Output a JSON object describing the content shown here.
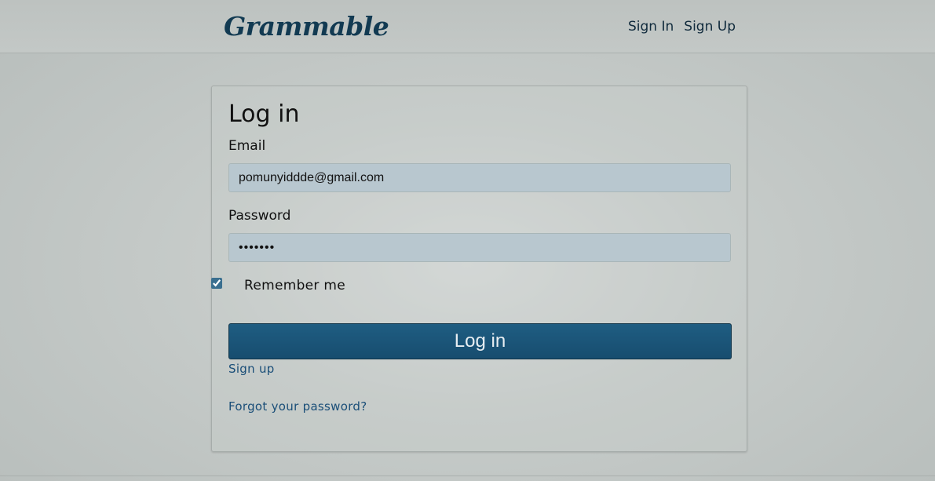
{
  "navbar": {
    "brand": "Grammable",
    "links": [
      {
        "label": "Sign In"
      },
      {
        "label": "Sign Up"
      }
    ]
  },
  "form": {
    "title": "Log in",
    "email": {
      "label": "Email",
      "value": "pomunyiddde@gmail.com"
    },
    "password": {
      "label": "Password",
      "value": "•••••••"
    },
    "remember": {
      "label": "Remember me",
      "checked": true
    },
    "submit_label": "Log in",
    "signup_link": "Sign up",
    "forgot_link": "Forgot your password?"
  },
  "colors": {
    "brand": "#123a52",
    "button": "#1f5d82",
    "link": "#1a4e78",
    "input_bg": "#b8c7cf"
  }
}
